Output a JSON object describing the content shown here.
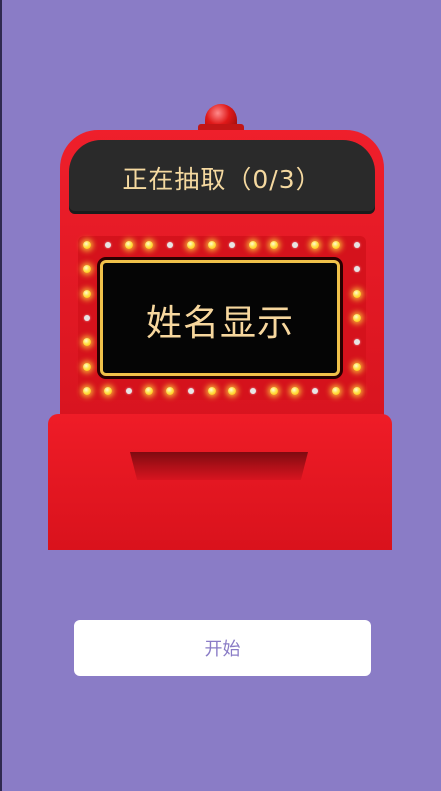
{
  "machine": {
    "status_text": "正在抽取（0/3）",
    "name_placeholder": "姓名显示"
  },
  "actions": {
    "start_label": "开始"
  },
  "colors": {
    "background": "#8a7cc6",
    "machine_red": "#e31b26",
    "screen_dark": "#2a2a2a",
    "screen_border": "#f0c14a",
    "text_gold": "#f7d79e",
    "button_bg": "#ffffff",
    "button_text": "#8a7cc6"
  }
}
